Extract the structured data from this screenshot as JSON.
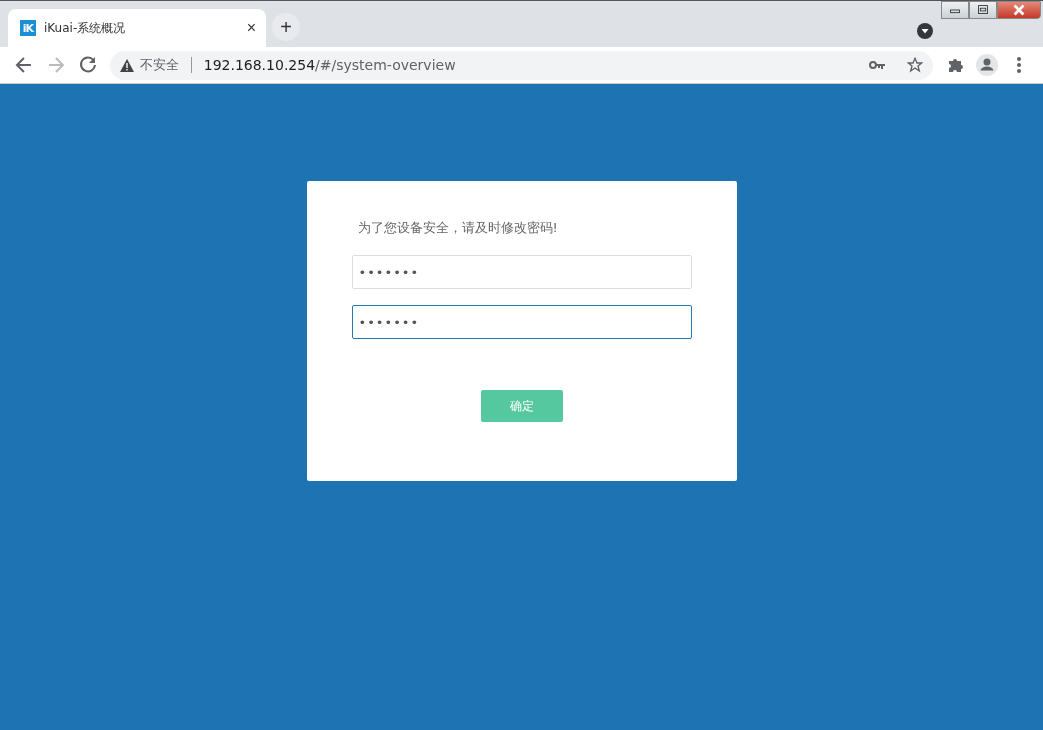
{
  "browser": {
    "tab": {
      "logo": "iK",
      "title": "iKuai-系统概况",
      "close": "×",
      "selected": true
    },
    "new_tab": "+",
    "security_label": "不安全",
    "url_host": "192.168.10.254",
    "url_path": "/#/system-overview"
  },
  "dialog": {
    "message": "为了您设备安全，请及时修改密码!",
    "fields": [
      {
        "value": "•••••••",
        "focused": false
      },
      {
        "value": "•••••••",
        "focused": true
      }
    ],
    "confirm": "确定"
  }
}
